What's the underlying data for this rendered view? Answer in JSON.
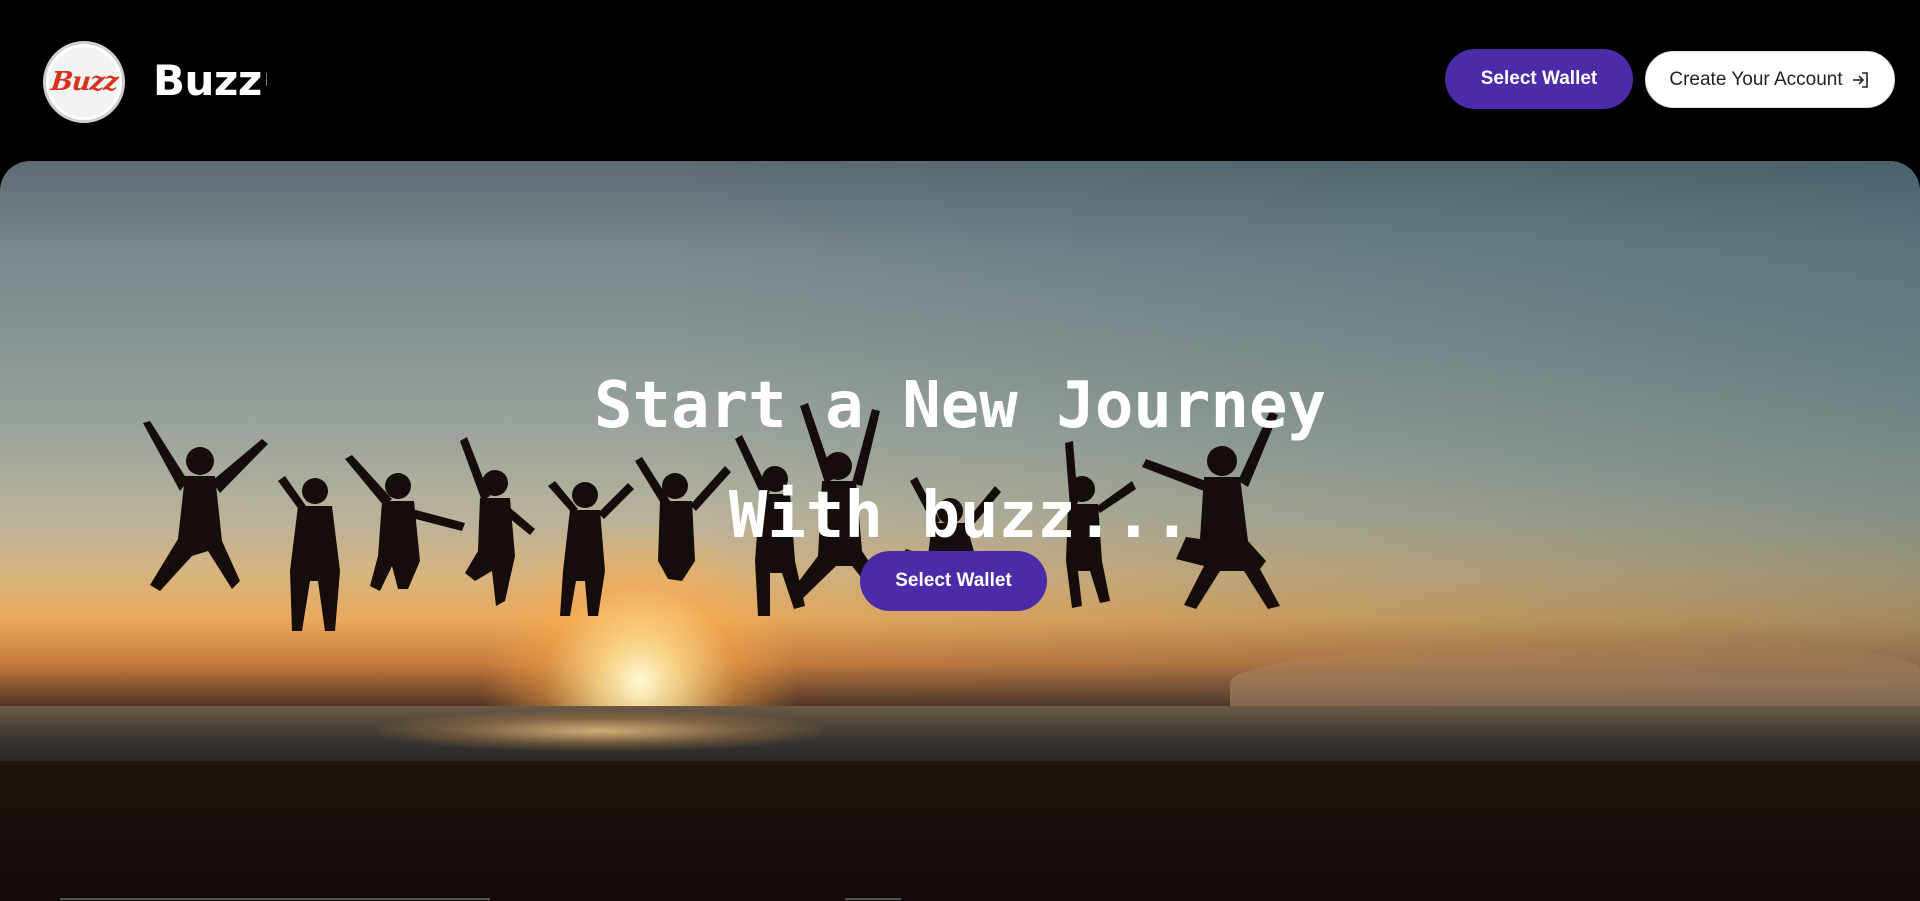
{
  "header": {
    "logo_text": "Buzz",
    "brand_name": "Buzz",
    "select_wallet_label": "Select Wallet",
    "create_account_label": "Create Your Account",
    "create_account_icon": "sign-in-icon"
  },
  "hero": {
    "title_line_1": "Start a New Journey",
    "title_line_2": "With buzz...",
    "select_wallet_label": "Select Wallet",
    "background": "sunset-beach-jumping-silhouettes"
  },
  "colors": {
    "accent": "#4b2ba8",
    "background": "#000000",
    "logo_red": "#d8321f"
  }
}
